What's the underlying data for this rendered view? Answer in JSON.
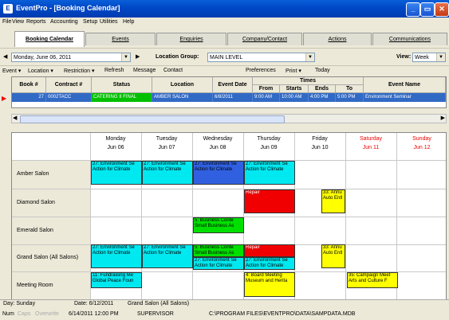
{
  "window": {
    "title": "EventPro - [Booking Calendar]",
    "app_icon": "E"
  },
  "menu": [
    "File",
    "View",
    "Reports",
    "Accounting",
    "Setup",
    "Utilities",
    "Help"
  ],
  "tabs": [
    "Booking Calendar",
    "Events",
    "Enquiries",
    "Company/Contact",
    "Actions",
    "Communications"
  ],
  "filter": {
    "date": "Monday, June 06, 2011",
    "location_group_label": "Location Group:",
    "location_group": "MAIN LEVEL",
    "view_label": "View:",
    "view": "Week"
  },
  "toolbar": [
    "Event ▾",
    "Location ▾",
    "Restriction ▾",
    "Refresh",
    "Message",
    "Contact",
    "Preferences",
    "Print ▾",
    "Today"
  ],
  "grid": {
    "headers": {
      "book": "Book #",
      "contract": "Contract #",
      "status": "Status",
      "location": "Location",
      "event_date": "Event Date",
      "times": "Times",
      "from": "From",
      "starts": "Starts",
      "ends": "Ends",
      "to": "To",
      "event_name": "Event Name"
    },
    "row": {
      "book": "27",
      "contract": "0002TACC",
      "status": "CATERING II FINAL",
      "location": "AMBER SALON",
      "event_date": "6/8/2011",
      "from": "9:00 AM",
      "starts": "10:00 AM",
      "ends": "4:00 PM",
      "to": "5:00 PM",
      "event_name": "Environment Seminar"
    }
  },
  "calendar": {
    "days": [
      {
        "dow": "Monday",
        "date": "Jun 06",
        "weekend": false
      },
      {
        "dow": "Tuesday",
        "date": "Jun 07",
        "weekend": false
      },
      {
        "dow": "Wednesday",
        "date": "Jun 08",
        "weekend": false
      },
      {
        "dow": "Thursday",
        "date": "Jun 09",
        "weekend": false
      },
      {
        "dow": "Friday",
        "date": "Jun 10",
        "weekend": false
      },
      {
        "dow": "Saturday",
        "date": "Jun 11",
        "weekend": true
      },
      {
        "dow": "Sunday",
        "date": "Jun 12",
        "weekend": true
      }
    ],
    "rooms": [
      "Amber Salon",
      "Diamond Salon",
      "Emerald Salon",
      "Grand Salon (All Salons)",
      "Meeting Room"
    ],
    "events": {
      "amber_1": "27: Environment Se\nAction for Climate",
      "amber_2": "27: Environment Se\nAction for Climate",
      "amber_3": "27: Environment Se\nAction for Climate",
      "amber_4": "27: Environment Se\nAction for Climate",
      "diamond_repair": "Repair",
      "diamond_fri": "33: Annu\nAuto Entl",
      "emerald_wed": "5: Business Conte\nSmall Business As",
      "grand_mon": "27: Environment Se\nAction for Climate",
      "grand_tue": "27: Environment Se\nAction for Climate",
      "grand_wed": "5: Business Conte\nSmall Business As",
      "grand_repair": "Repair",
      "grand_thu2": "27: Environment Se\nAction for Climate",
      "grand_wed2": "27: Environment Se\nAction for Climate",
      "grand_fri": "33: Annu\nAuto Entl",
      "meeting_mon": "11: Fundraising Me\nGlobal Peace Foun",
      "meeting_thu": "4: Board Meeting\nMuseum and Herita",
      "meeting_sat": "35: Campaign Meet\nArts and Culture F"
    }
  },
  "status": {
    "day": "Day: Sunday",
    "date": "Date: 6/12/2011",
    "room": "Grand Salon (All Salons)"
  },
  "statusbar": {
    "num": "Num",
    "caps": "Caps",
    "overwrite": "Overwrite",
    "datetime": "6/14/2011 12:00 PM",
    "user": "SUPERVISOR",
    "path": "C:\\PROGRAM FILES\\EVENTPRO\\DATA\\SAMPDATA.MDB"
  },
  "colors": {
    "cyan": "#00e8f0",
    "blue": "#3060e0",
    "red": "#f00000",
    "yellow": "#ffff00",
    "green": "#00e000",
    "selection": "#316ac5"
  }
}
